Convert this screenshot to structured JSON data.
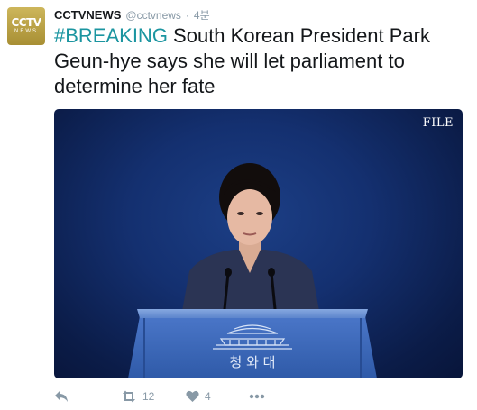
{
  "account": {
    "display_name": "CCTVNEWS",
    "handle": "@cctvnews",
    "separator": "·",
    "time": "4분",
    "avatar_logo": "CCTV",
    "avatar_sub": "NEWS"
  },
  "tweet": {
    "hashtag": "#BREAKING",
    "text": " South Korean President Park Geun-hye says she will let parliament to determine her fate"
  },
  "media": {
    "label": "FILE",
    "podium_text": "청 와 대"
  },
  "actions": {
    "reply_icon": "reply-icon",
    "retweet_icon": "retweet-icon",
    "retweet_count": "12",
    "like_icon": "heart-icon",
    "like_count": "4",
    "more_icon": "more-dots-icon"
  },
  "colors": {
    "hashtag": "#1b95a0",
    "muted": "#8899a6",
    "text": "#14171a",
    "avatar": "#b89f42"
  }
}
